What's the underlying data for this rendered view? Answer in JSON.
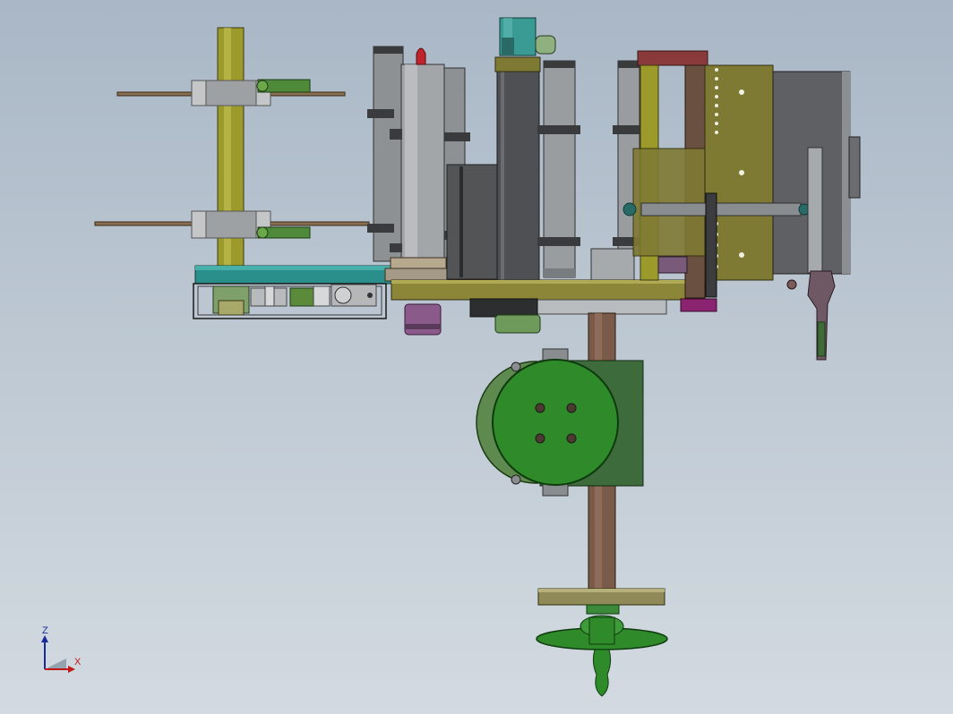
{
  "view": {
    "triad": {
      "z_label": "Z",
      "x_label": "X"
    },
    "colors": {
      "background_top": "#a9b7c6",
      "background_bottom": "#d3dae1",
      "olive": "#7f7a33",
      "dark_olive": "#5c5a1a",
      "steel": "#8e9194",
      "dark_steel": "#4e5053",
      "green": "#2e7a2a",
      "teal": "#2a8f8a",
      "brown": "#6a5040",
      "maroon": "#8a3a3a",
      "magenta": "#8a2470",
      "yellow_shaft": "#9c9a2a"
    }
  }
}
